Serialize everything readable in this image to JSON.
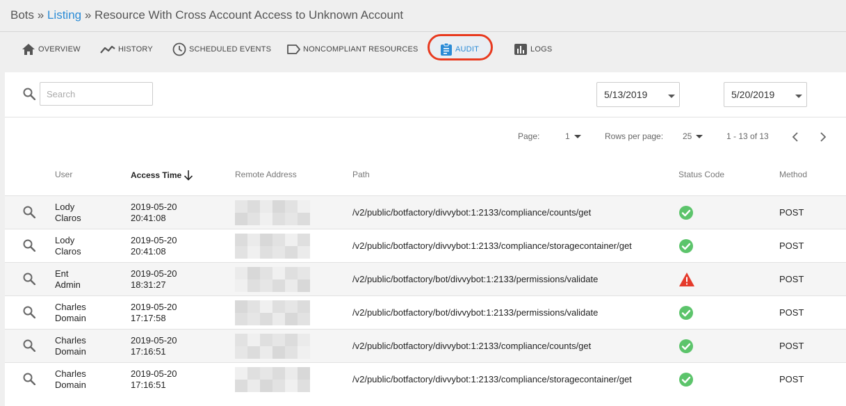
{
  "breadcrumb": {
    "root": "Bots",
    "separator": "»",
    "link": "Listing",
    "current": "Resource With Cross Account Access to Unknown Account"
  },
  "tabs": [
    {
      "label": "OVERVIEW",
      "icon": "home-icon"
    },
    {
      "label": "HISTORY",
      "icon": "trend-line-icon"
    },
    {
      "label": "SCHEDULED EVENTS",
      "icon": "clock-icon"
    },
    {
      "label": "NONCOMPLIANT RESOURCES",
      "icon": "tag-icon"
    },
    {
      "label": "AUDIT",
      "icon": "clipboard-icon",
      "active": true
    },
    {
      "label": "LOGS",
      "icon": "bar-chart-icon"
    }
  ],
  "search": {
    "placeholder": "Search",
    "value": ""
  },
  "date_range": {
    "start": "5/13/2019",
    "end": "5/20/2019"
  },
  "pagination": {
    "page_label": "Page:",
    "page": "1",
    "rows_label": "Rows per page:",
    "rows": "25",
    "range": "1 - 13 of 13"
  },
  "columns": {
    "user": "User",
    "access_time": "Access Time",
    "remote_address": "Remote Address",
    "path": "Path",
    "status_code": "Status Code",
    "method": "Method"
  },
  "rows": [
    {
      "user1": "Lody",
      "user2": "Claros",
      "date": "2019-05-20",
      "time": "20:41:08",
      "path": "/v2/public/botfactory/divvybot:1:2133/compliance/counts/get",
      "status": "success",
      "method": "POST"
    },
    {
      "user1": "Lody",
      "user2": "Claros",
      "date": "2019-05-20",
      "time": "20:41:08",
      "path": "/v2/public/botfactory/divvybot:1:2133/compliance/storagecontainer/get",
      "status": "success",
      "method": "POST"
    },
    {
      "user1": "Ent",
      "user2": "Admin",
      "date": "2019-05-20",
      "time": "18:31:27",
      "path": "/v2/public/botfactory/bot/divvybot:1:2133/permissions/validate",
      "status": "error",
      "method": "POST"
    },
    {
      "user1": "Charles",
      "user2": "Domain",
      "date": "2019-05-20",
      "time": "17:17:58",
      "path": "/v2/public/botfactory/bot/divvybot:1:2133/permissions/validate",
      "status": "success",
      "method": "POST"
    },
    {
      "user1": "Charles",
      "user2": "Domain",
      "date": "2019-05-20",
      "time": "17:16:51",
      "path": "/v2/public/botfactory/divvybot:1:2133/compliance/counts/get",
      "status": "success",
      "method": "POST"
    },
    {
      "user1": "Charles",
      "user2": "Domain",
      "date": "2019-05-20",
      "time": "17:16:51",
      "path": "/v2/public/botfactory/divvybot:1:2133/compliance/storagecontainer/get",
      "status": "success",
      "method": "POST"
    }
  ],
  "colors": {
    "link": "#2a8bd6",
    "highlight_ring": "#e83a1f",
    "success": "#5cc46b",
    "error": "#e53a2b"
  }
}
